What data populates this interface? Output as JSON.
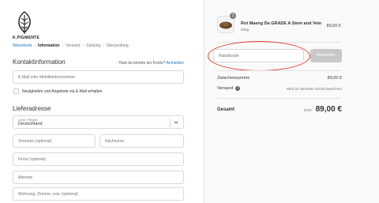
{
  "brand": {
    "name": "K.PIGMENTE"
  },
  "breadcrumb": {
    "items": [
      {
        "label": "Warenkorb"
      },
      {
        "label": "Information"
      },
      {
        "label": "Versand"
      },
      {
        "label": "Zahlung"
      },
      {
        "label": "Überprüfung"
      }
    ],
    "separator": "›"
  },
  "contact": {
    "title": "Kontaktinformation",
    "account_hint": "Hast du bereits ein Konto?",
    "login_link": "Anmelden",
    "email_placeholder": "E-Mail oder Mobiltelefonnummer",
    "newsletter_label": "Neuigkeiten und Angebote via E-Mail erhalten"
  },
  "shipping": {
    "title": "Lieferadresse",
    "country_label": "Land / Region",
    "country_value": "Deutschland",
    "firstname_placeholder": "Vorname (optional)",
    "lastname_placeholder": "Nachname",
    "company_placeholder": "Firma (optional)",
    "address_placeholder": "Adresse",
    "address2_placeholder": "Wohnung, Zimmer, usw. (optional)"
  },
  "order": {
    "product": {
      "name": "Rot Maeng Da GRADE A Stem and Vein",
      "variant": "500g",
      "price": "89,00 €",
      "quantity": "1"
    },
    "discount_placeholder": "Rabattcode",
    "apply_label": "Anwenden",
    "subtotal_label": "Zwischensumme",
    "subtotal_value": "89,00 €",
    "shipping_label": "Versand",
    "shipping_note": "Wird im nächsten Schritt berechnet",
    "total_label": "Gesamt",
    "total_currency": "EUR",
    "total_value": "89,00 €"
  },
  "colors": {
    "link": "#1a73b9",
    "highlight_oval": "#e23b2e",
    "summary_bg": "#fafafa"
  }
}
